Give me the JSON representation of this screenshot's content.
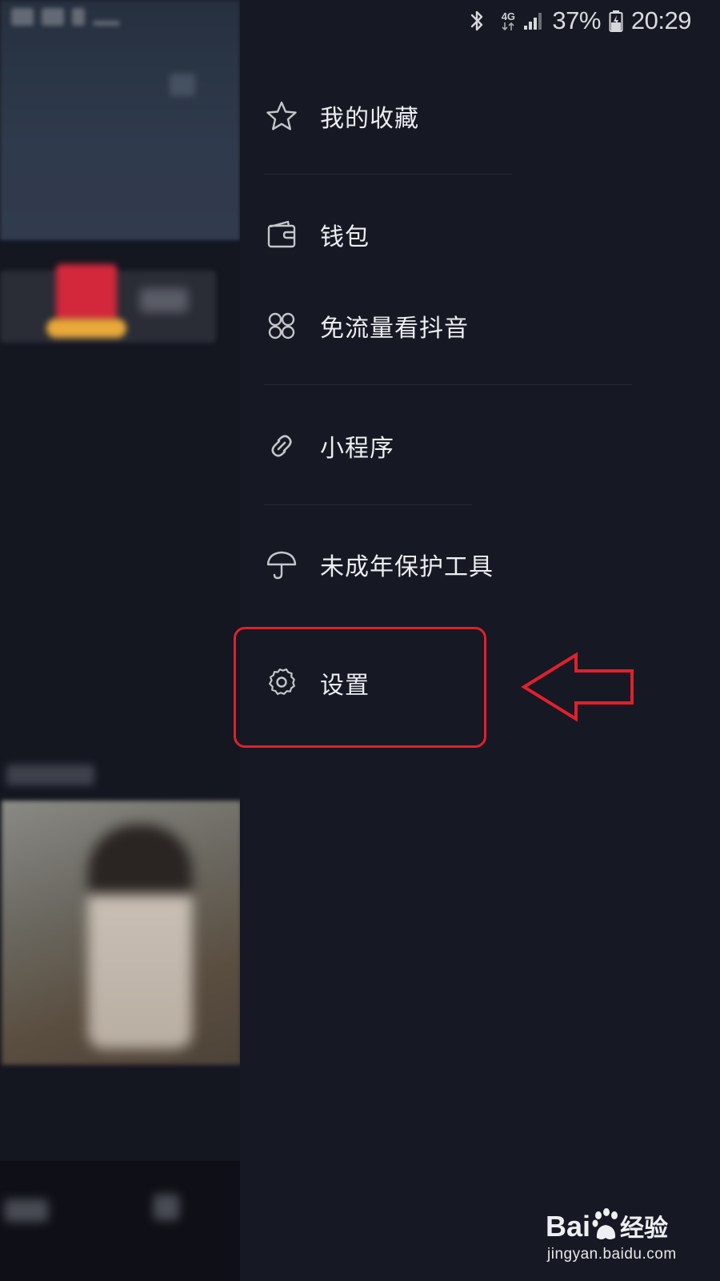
{
  "status_bar": {
    "network": "4G",
    "battery": "37%",
    "time": "20:29",
    "icons": [
      "bluetooth-icon",
      "network-4g-icon",
      "signal-icon",
      "battery-charging-icon"
    ]
  },
  "drawer": {
    "items": [
      {
        "id": "favorites",
        "label": "我的收藏",
        "icon": "star-icon"
      },
      {
        "id": "wallet",
        "label": "钱包",
        "icon": "wallet-icon"
      },
      {
        "id": "free-data",
        "label": "免流量看抖音",
        "icon": "four-circles-icon"
      },
      {
        "id": "mini-programs",
        "label": "小程序",
        "icon": "link-icon"
      },
      {
        "id": "minor-protection",
        "label": "未成年保护工具",
        "icon": "umbrella-icon"
      },
      {
        "id": "settings",
        "label": "设置",
        "icon": "gear-icon"
      }
    ]
  },
  "annotation": {
    "highlight_color": "#e0202e",
    "highlighted_item": "settings"
  },
  "watermark": {
    "logo_text": "Baidu经验",
    "url": "jingyan.baidu.com"
  },
  "colors": {
    "drawer_bg": "#161823",
    "text": "#eceef2",
    "icon": "#c4c6cc",
    "annotation_red": "#e0202e"
  }
}
